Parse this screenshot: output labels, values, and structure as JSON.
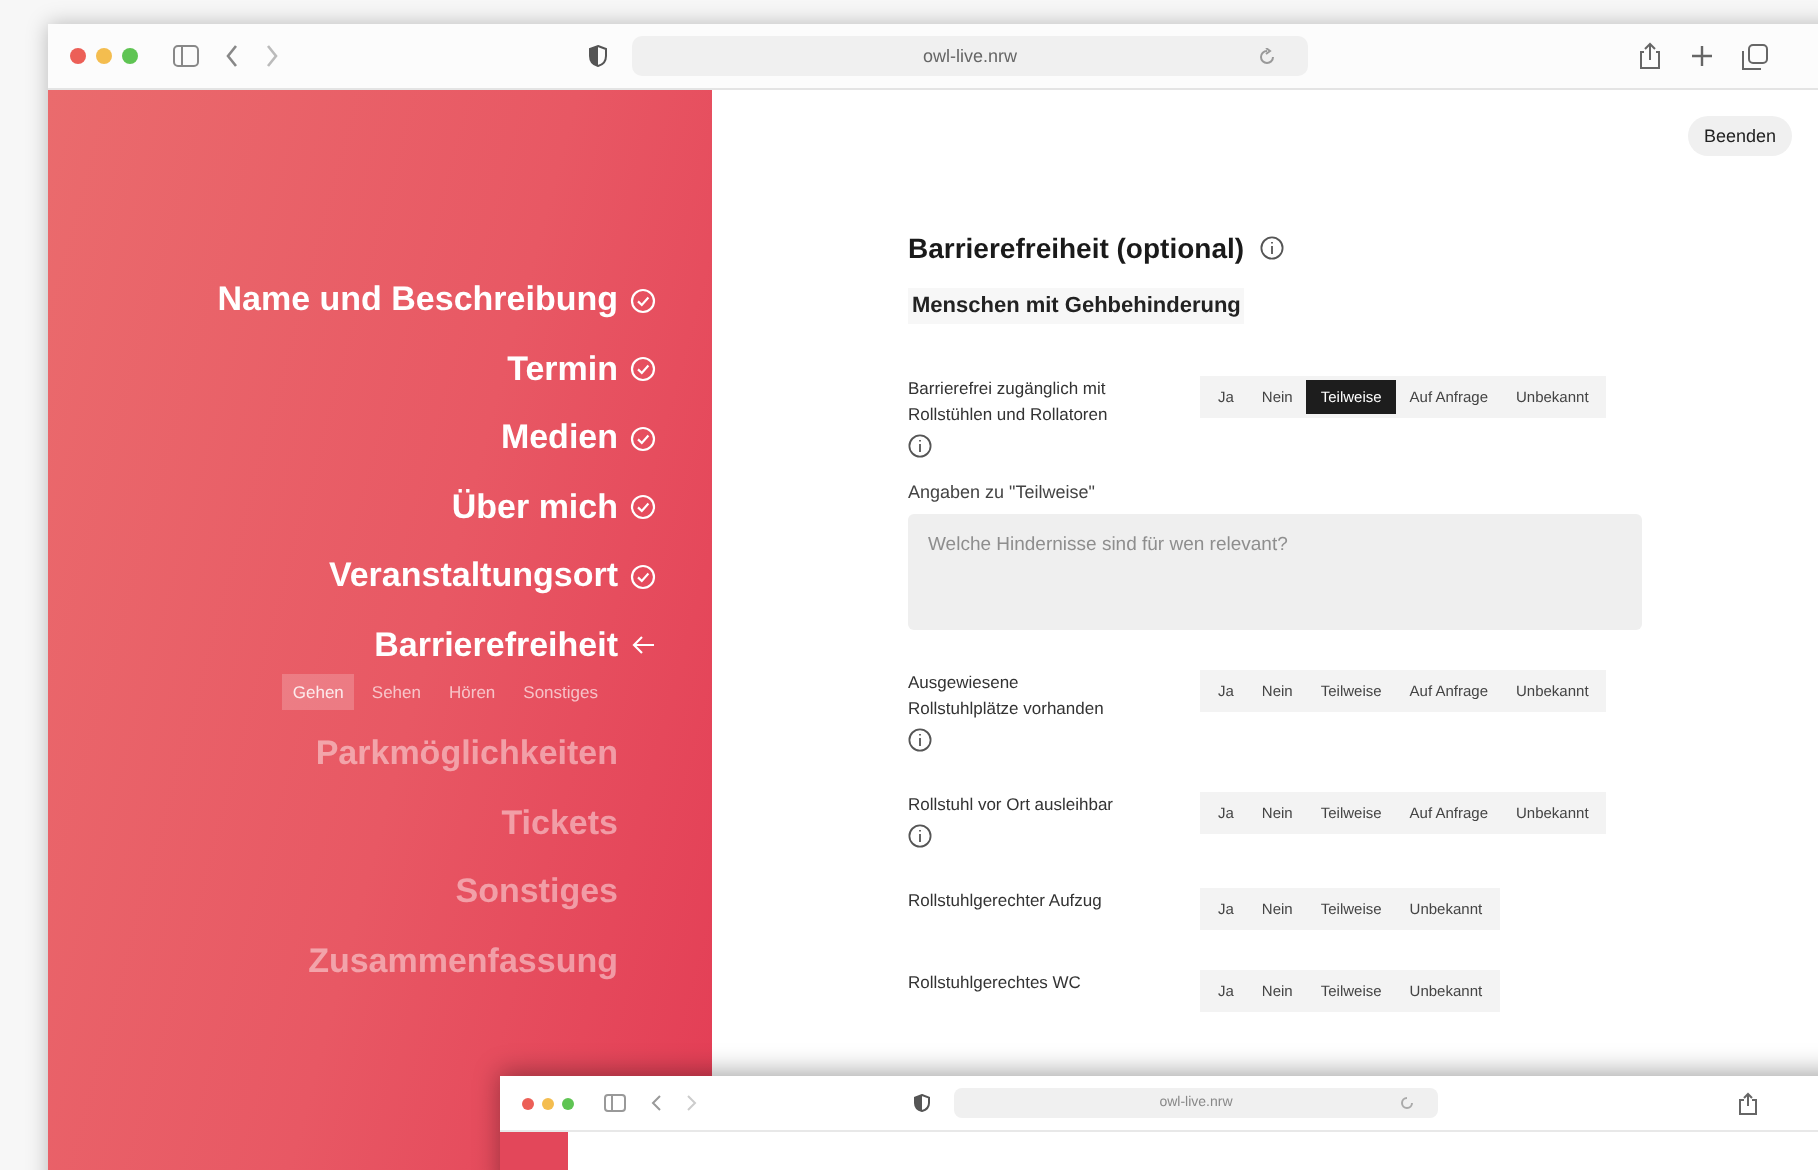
{
  "window": {
    "url": "owl-live.nrw"
  },
  "end_button": "Beenden",
  "sidebar": {
    "steps": [
      {
        "label": "Name und Beschreibung",
        "done": true,
        "current": false
      },
      {
        "label": "Termin",
        "done": true,
        "current": false
      },
      {
        "label": "Medien",
        "done": true,
        "current": false
      },
      {
        "label": "Über mich",
        "done": true,
        "current": false
      },
      {
        "label": "Veranstaltungsort",
        "done": true,
        "current": false
      },
      {
        "label": "Barrierefreiheit",
        "done": false,
        "current": true,
        "subtabs": [
          {
            "label": "Gehen",
            "selected": true
          },
          {
            "label": "Sehen",
            "selected": false
          },
          {
            "label": "Hören",
            "selected": false
          },
          {
            "label": "Sonstiges",
            "selected": false
          }
        ]
      },
      {
        "label": "Parkmöglichkeiten",
        "done": false,
        "current": false
      },
      {
        "label": "Tickets",
        "done": false,
        "current": false
      },
      {
        "label": "Sonstiges",
        "done": false,
        "current": false
      },
      {
        "label": "Zusammenfassung",
        "done": false,
        "current": false
      }
    ]
  },
  "form": {
    "title": "Barrierefreiheit (optional)",
    "section": "Menschen mit Gehbehinderung",
    "questions": [
      {
        "label": "Barrierefrei zugänglich mit Rollstühlen und Rollatoren",
        "info": true,
        "options": [
          {
            "label": "Ja",
            "selected": false
          },
          {
            "label": "Nein",
            "selected": false
          },
          {
            "label": "Teilweise",
            "selected": true
          },
          {
            "label": "Auf Anfrage",
            "selected": false
          },
          {
            "label": "Unbekannt",
            "selected": false
          }
        ],
        "detail": {
          "label": "Angaben zu \"Teilweise\"",
          "placeholder": "Welche Hindernisse sind für wen relevant?"
        }
      },
      {
        "label": "Ausgewiesene Rollstuhlplätze vorhanden",
        "info": true,
        "options": [
          {
            "label": "Ja",
            "selected": false
          },
          {
            "label": "Nein",
            "selected": false
          },
          {
            "label": "Teilweise",
            "selected": false
          },
          {
            "label": "Auf Anfrage",
            "selected": false
          },
          {
            "label": "Unbekannt",
            "selected": false
          }
        ]
      },
      {
        "label": "Rollstuhl vor Ort ausleihbar",
        "info": true,
        "options": [
          {
            "label": "Ja",
            "selected": false
          },
          {
            "label": "Nein",
            "selected": false
          },
          {
            "label": "Teilweise",
            "selected": false
          },
          {
            "label": "Auf Anfrage",
            "selected": false
          },
          {
            "label": "Unbekannt",
            "selected": false
          }
        ]
      },
      {
        "label": "Rollstuhlgerechter Aufzug",
        "info": false,
        "options": [
          {
            "label": "Ja",
            "selected": false
          },
          {
            "label": "Nein",
            "selected": false
          },
          {
            "label": "Teilweise",
            "selected": false
          },
          {
            "label": "Unbekannt",
            "selected": false
          }
        ]
      },
      {
        "label": "Rollstuhlgerechtes WC",
        "info": false,
        "options": [
          {
            "label": "Ja",
            "selected": false
          },
          {
            "label": "Nein",
            "selected": false
          },
          {
            "label": "Teilweise",
            "selected": false
          },
          {
            "label": "Unbekannt",
            "selected": false
          }
        ]
      }
    ]
  },
  "second_window": {
    "url": "owl-live.nrw"
  }
}
